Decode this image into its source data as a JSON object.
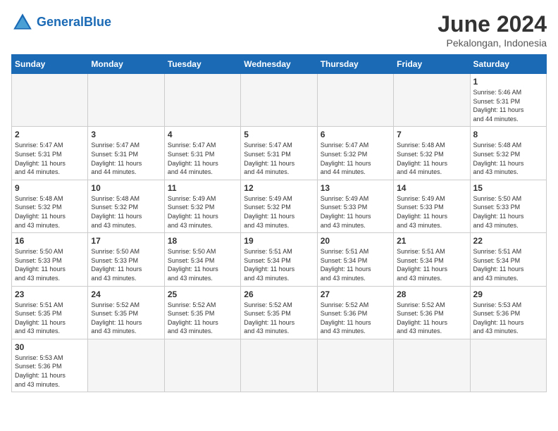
{
  "header": {
    "logo_general": "General",
    "logo_blue": "Blue",
    "title": "June 2024",
    "subtitle": "Pekalongan, Indonesia"
  },
  "weekdays": [
    "Sunday",
    "Monday",
    "Tuesday",
    "Wednesday",
    "Thursday",
    "Friday",
    "Saturday"
  ],
  "weeks": [
    [
      {
        "day": "",
        "info": ""
      },
      {
        "day": "",
        "info": ""
      },
      {
        "day": "",
        "info": ""
      },
      {
        "day": "",
        "info": ""
      },
      {
        "day": "",
        "info": ""
      },
      {
        "day": "",
        "info": ""
      },
      {
        "day": "1",
        "info": "Sunrise: 5:46 AM\nSunset: 5:31 PM\nDaylight: 11 hours\nand 44 minutes."
      }
    ],
    [
      {
        "day": "2",
        "info": "Sunrise: 5:47 AM\nSunset: 5:31 PM\nDaylight: 11 hours\nand 44 minutes."
      },
      {
        "day": "3",
        "info": "Sunrise: 5:47 AM\nSunset: 5:31 PM\nDaylight: 11 hours\nand 44 minutes."
      },
      {
        "day": "4",
        "info": "Sunrise: 5:47 AM\nSunset: 5:31 PM\nDaylight: 11 hours\nand 44 minutes."
      },
      {
        "day": "5",
        "info": "Sunrise: 5:47 AM\nSunset: 5:31 PM\nDaylight: 11 hours\nand 44 minutes."
      },
      {
        "day": "6",
        "info": "Sunrise: 5:47 AM\nSunset: 5:32 PM\nDaylight: 11 hours\nand 44 minutes."
      },
      {
        "day": "7",
        "info": "Sunrise: 5:48 AM\nSunset: 5:32 PM\nDaylight: 11 hours\nand 44 minutes."
      },
      {
        "day": "8",
        "info": "Sunrise: 5:48 AM\nSunset: 5:32 PM\nDaylight: 11 hours\nand 43 minutes."
      }
    ],
    [
      {
        "day": "9",
        "info": "Sunrise: 5:48 AM\nSunset: 5:32 PM\nDaylight: 11 hours\nand 43 minutes."
      },
      {
        "day": "10",
        "info": "Sunrise: 5:48 AM\nSunset: 5:32 PM\nDaylight: 11 hours\nand 43 minutes."
      },
      {
        "day": "11",
        "info": "Sunrise: 5:49 AM\nSunset: 5:32 PM\nDaylight: 11 hours\nand 43 minutes."
      },
      {
        "day": "12",
        "info": "Sunrise: 5:49 AM\nSunset: 5:32 PM\nDaylight: 11 hours\nand 43 minutes."
      },
      {
        "day": "13",
        "info": "Sunrise: 5:49 AM\nSunset: 5:33 PM\nDaylight: 11 hours\nand 43 minutes."
      },
      {
        "day": "14",
        "info": "Sunrise: 5:49 AM\nSunset: 5:33 PM\nDaylight: 11 hours\nand 43 minutes."
      },
      {
        "day": "15",
        "info": "Sunrise: 5:50 AM\nSunset: 5:33 PM\nDaylight: 11 hours\nand 43 minutes."
      }
    ],
    [
      {
        "day": "16",
        "info": "Sunrise: 5:50 AM\nSunset: 5:33 PM\nDaylight: 11 hours\nand 43 minutes."
      },
      {
        "day": "17",
        "info": "Sunrise: 5:50 AM\nSunset: 5:33 PM\nDaylight: 11 hours\nand 43 minutes."
      },
      {
        "day": "18",
        "info": "Sunrise: 5:50 AM\nSunset: 5:34 PM\nDaylight: 11 hours\nand 43 minutes."
      },
      {
        "day": "19",
        "info": "Sunrise: 5:51 AM\nSunset: 5:34 PM\nDaylight: 11 hours\nand 43 minutes."
      },
      {
        "day": "20",
        "info": "Sunrise: 5:51 AM\nSunset: 5:34 PM\nDaylight: 11 hours\nand 43 minutes."
      },
      {
        "day": "21",
        "info": "Sunrise: 5:51 AM\nSunset: 5:34 PM\nDaylight: 11 hours\nand 43 minutes."
      },
      {
        "day": "22",
        "info": "Sunrise: 5:51 AM\nSunset: 5:34 PM\nDaylight: 11 hours\nand 43 minutes."
      }
    ],
    [
      {
        "day": "23",
        "info": "Sunrise: 5:51 AM\nSunset: 5:35 PM\nDaylight: 11 hours\nand 43 minutes."
      },
      {
        "day": "24",
        "info": "Sunrise: 5:52 AM\nSunset: 5:35 PM\nDaylight: 11 hours\nand 43 minutes."
      },
      {
        "day": "25",
        "info": "Sunrise: 5:52 AM\nSunset: 5:35 PM\nDaylight: 11 hours\nand 43 minutes."
      },
      {
        "day": "26",
        "info": "Sunrise: 5:52 AM\nSunset: 5:35 PM\nDaylight: 11 hours\nand 43 minutes."
      },
      {
        "day": "27",
        "info": "Sunrise: 5:52 AM\nSunset: 5:36 PM\nDaylight: 11 hours\nand 43 minutes."
      },
      {
        "day": "28",
        "info": "Sunrise: 5:52 AM\nSunset: 5:36 PM\nDaylight: 11 hours\nand 43 minutes."
      },
      {
        "day": "29",
        "info": "Sunrise: 5:53 AM\nSunset: 5:36 PM\nDaylight: 11 hours\nand 43 minutes."
      }
    ],
    [
      {
        "day": "30",
        "info": "Sunrise: 5:53 AM\nSunset: 5:36 PM\nDaylight: 11 hours\nand 43 minutes."
      },
      {
        "day": "",
        "info": ""
      },
      {
        "day": "",
        "info": ""
      },
      {
        "day": "",
        "info": ""
      },
      {
        "day": "",
        "info": ""
      },
      {
        "day": "",
        "info": ""
      },
      {
        "day": "",
        "info": ""
      }
    ]
  ]
}
